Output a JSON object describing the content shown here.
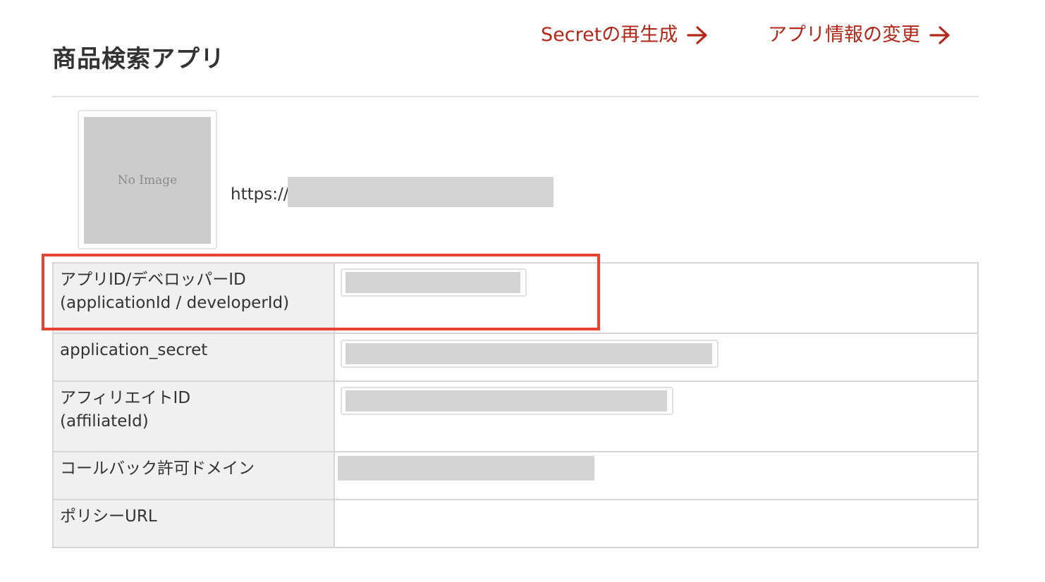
{
  "header": {
    "title": "商品検索アプリ",
    "links": [
      {
        "label": "Secretの再生成",
        "icon": "arrow-right-icon"
      },
      {
        "label": "アプリ情報の変更",
        "icon": "arrow-right-icon"
      }
    ]
  },
  "app": {
    "thumbnail_text": "No Image",
    "url_prefix": "https://"
  },
  "table": {
    "rows": [
      {
        "label_line1": "アプリID/デベロッパーID",
        "label_line2": "(applicationId / developerId)"
      },
      {
        "label_line1": "application_secret"
      },
      {
        "label_line1": "アフィリエイトID",
        "label_line2": "(affiliateId)"
      },
      {
        "label_line1": "コールバック許可ドメイン"
      },
      {
        "label_line1": "ポリシーURL"
      }
    ]
  },
  "colors": {
    "link": "#b32718",
    "highlight": "#e84332",
    "label_bg": "#f0f0f0",
    "redaction": "#d4d4d4"
  }
}
